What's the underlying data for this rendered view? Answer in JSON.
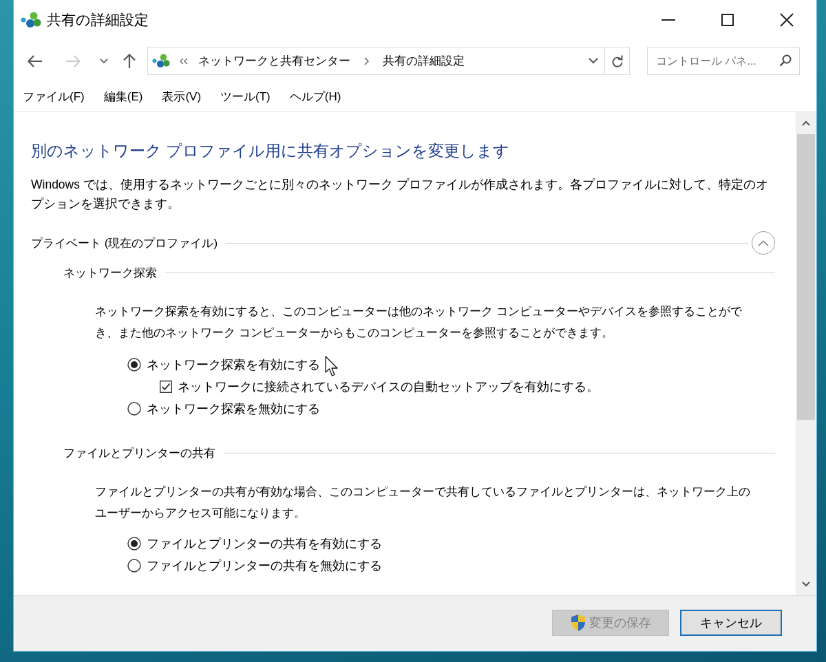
{
  "window": {
    "title": "共有の詳細設定"
  },
  "navigation": {
    "back": {
      "disabled": false
    },
    "forward": {
      "disabled": true
    },
    "up": {
      "disabled": false
    },
    "address": {
      "path": [
        "ネットワークと共有センター",
        "共有の詳細設定"
      ]
    },
    "search": {
      "placeholder": "コントロール パネ..."
    }
  },
  "menu": [
    {
      "label": "ファイル(F)"
    },
    {
      "label": "編集(E)"
    },
    {
      "label": "表示(V)"
    },
    {
      "label": "ツール(T)"
    },
    {
      "label": "ヘルプ(H)"
    }
  ],
  "content": {
    "heading": "別のネットワーク プロファイル用に共有オプションを変更します",
    "intro": "Windows では、使用するネットワークごとに別々のネットワーク プロファイルが作成されます。各プロファイルに対して、特定のオプションを選択できます。",
    "profiles": [
      {
        "title": "プライベート (現在のプロファイル)",
        "expanded": true,
        "sections": [
          {
            "title": "ネットワーク探索",
            "description": "ネットワーク探索を有効にすると、このコンピューターは他のネットワーク コンピューターやデバイスを参照することができ、また他のネットワーク コンピューターからもこのコンピューターを参照することができます。",
            "options": [
              {
                "kind": "radio",
                "label": "ネットワーク探索を有効にする",
                "selected": true,
                "children": [
                  {
                    "kind": "checkbox",
                    "label": "ネットワークに接続されているデバイスの自動セットアップを有効にする。",
                    "checked": true
                  }
                ]
              },
              {
                "kind": "radio",
                "label": "ネットワーク探索を無効にする",
                "selected": false
              }
            ]
          },
          {
            "title": "ファイルとプリンターの共有",
            "description": "ファイルとプリンターの共有が有効な場合、このコンピューターで共有しているファイルとプリンターは、ネットワーク上のユーザーからアクセス可能になります。",
            "options": [
              {
                "kind": "radio",
                "label": "ファイルとプリンターの共有を有効にする",
                "selected": true
              },
              {
                "kind": "radio",
                "label": "ファイルとプリンターの共有を無効にする",
                "selected": false
              }
            ]
          }
        ]
      }
    ]
  },
  "buttons": [
    {
      "label": "変更の保存",
      "kind": "uac",
      "disabled": true,
      "focused": false
    },
    {
      "label": "キャンセル",
      "kind": "plain",
      "disabled": false,
      "focused": true
    }
  ]
}
